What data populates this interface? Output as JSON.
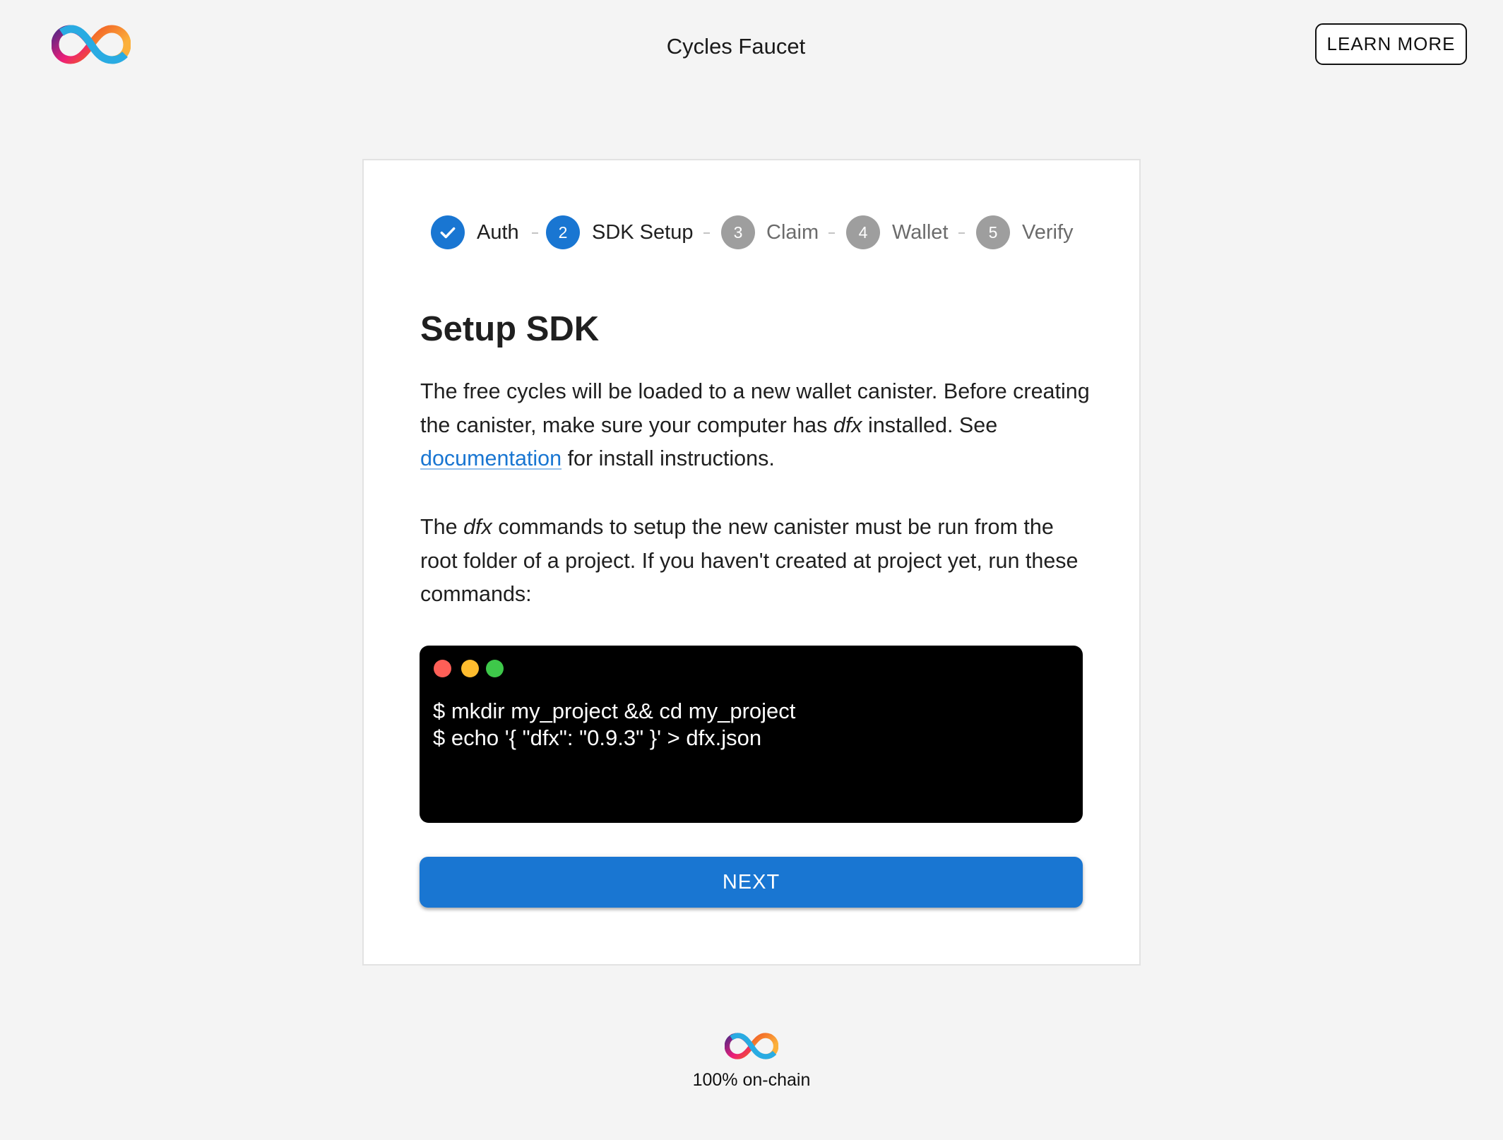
{
  "header": {
    "logo_icon": "infinity-logo-icon",
    "title": "Cycles Faucet",
    "learn_more_label": "LEARN MORE"
  },
  "stepper": {
    "steps": [
      {
        "label": "Auth",
        "marker": "✓",
        "state": "completed",
        "icon": "check-icon"
      },
      {
        "label": "SDK Setup",
        "marker": "2",
        "state": "active"
      },
      {
        "label": "Claim",
        "marker": "3",
        "state": "inactive"
      },
      {
        "label": "Wallet",
        "marker": "4",
        "state": "inactive"
      },
      {
        "label": "Verify",
        "marker": "5",
        "state": "inactive"
      }
    ],
    "active_color": "#1976d2",
    "inactive_color": "#9e9e9e"
  },
  "main": {
    "heading": "Setup SDK",
    "para1": {
      "text_a": "The free cycles will be loaded to a new wallet canister. Before creating the canister, make sure your computer has ",
      "italic": "dfx",
      "text_b": " installed. See ",
      "link_label": "documentation",
      "text_c": " for install instructions."
    },
    "para2": {
      "text_a": "The ",
      "italic": "dfx",
      "text_b": " commands to setup the new canister must be run from the root folder of a project. If you haven't created at project yet, run these commands:"
    },
    "terminal": {
      "dots": [
        "#fe5f57",
        "#febc2e",
        "#3ec84a"
      ],
      "commands": [
        "$ mkdir my_project && cd my_project",
        "$ echo '{ \"dfx\": \"0.9.3\" }' > dfx.json"
      ]
    },
    "next_label": "NEXT",
    "accent_color": "#1976d2"
  },
  "footer": {
    "logo_icon": "infinity-logo-icon",
    "text": "100% on-chain"
  }
}
